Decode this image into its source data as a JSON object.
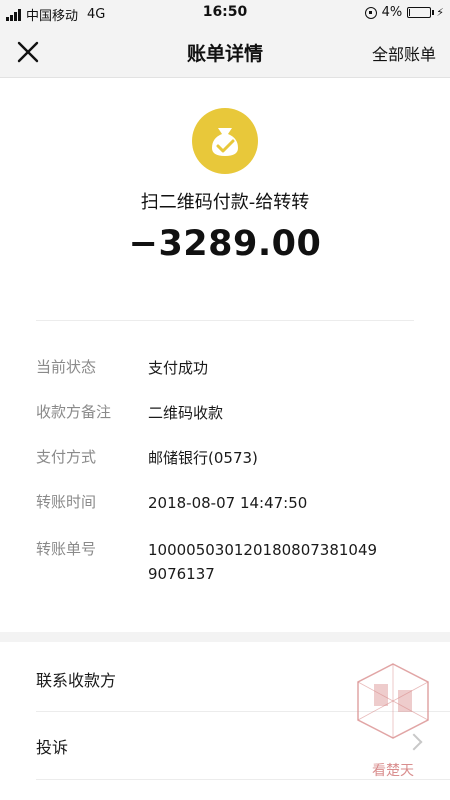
{
  "status_bar": {
    "carrier": "中国移动",
    "network": "4G",
    "time": "16:50",
    "battery": "4%",
    "battery_level": 0.04
  },
  "nav": {
    "title": "账单详情",
    "right_action": "全部账单"
  },
  "bill": {
    "merchant": "扫二维码付款-给转转",
    "amount": "−3289.00",
    "icon": "money-bag-check-icon",
    "icon_color": "#e8c83a"
  },
  "details": [
    {
      "label": "当前状态",
      "value": "支付成功"
    },
    {
      "label": "收款方备注",
      "value": "二维码收款"
    },
    {
      "label": "支付方式",
      "value": "邮储银行(0573)"
    },
    {
      "label": "转账时间",
      "value": "2018-08-07 14:47:50"
    },
    {
      "label": "转账单号",
      "value": "100005030120180807381049 9076137"
    }
  ],
  "actions": [
    {
      "label": "联系收款方"
    },
    {
      "label": "投诉"
    }
  ],
  "watermark": {
    "text": "看楚天",
    "color": "#d98e8e"
  }
}
